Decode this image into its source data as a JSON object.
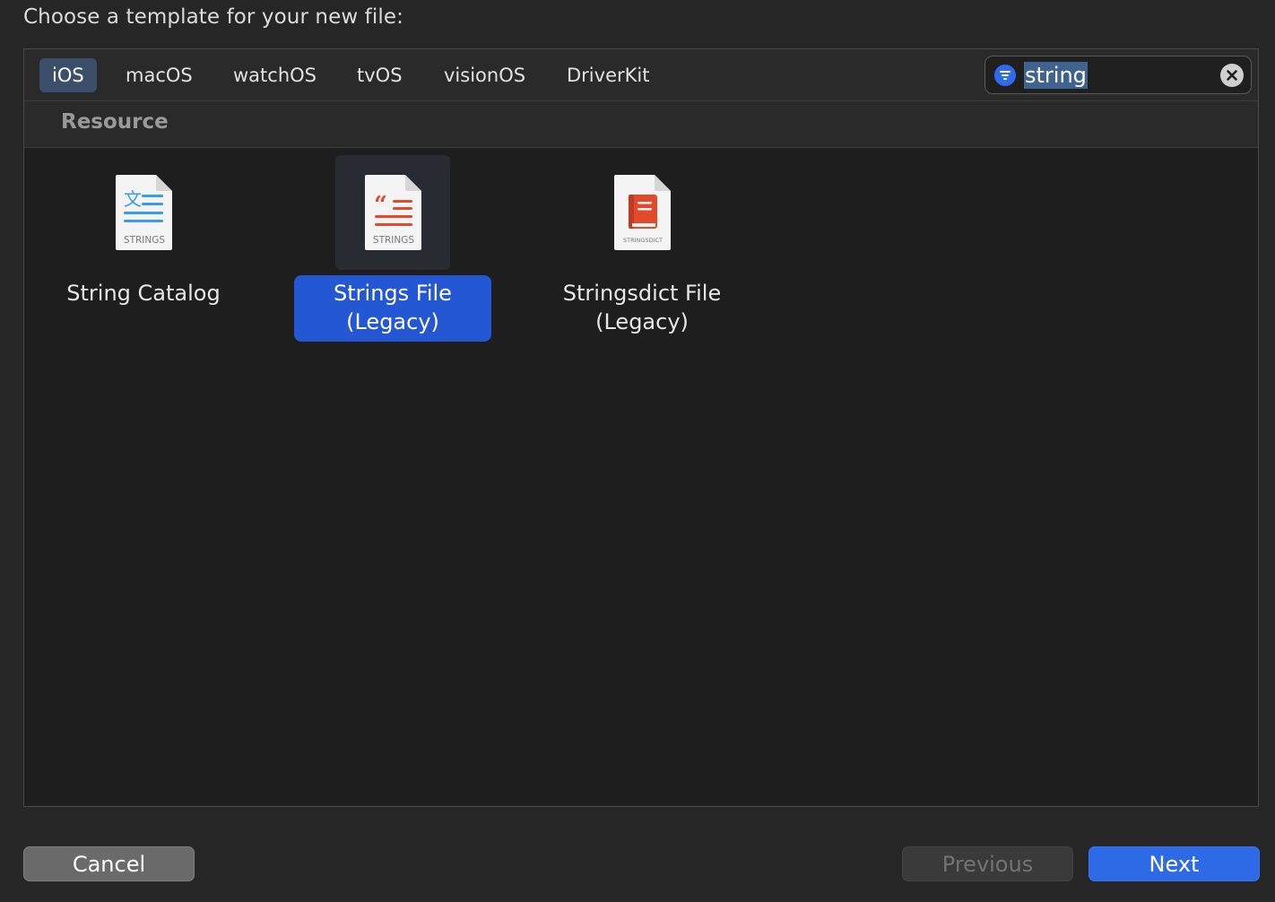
{
  "dialog": {
    "title": "Choose a template for your new file:"
  },
  "platform_tabs": [
    {
      "label": "iOS",
      "selected": true
    },
    {
      "label": "macOS",
      "selected": false
    },
    {
      "label": "watchOS",
      "selected": false
    },
    {
      "label": "tvOS",
      "selected": false
    },
    {
      "label": "visionOS",
      "selected": false
    },
    {
      "label": "DriverKit",
      "selected": false
    }
  ],
  "search": {
    "value": "string",
    "leading_icon": "filter-icon",
    "trailing_icon": "clear-icon"
  },
  "section": {
    "title": "Resource"
  },
  "templates": [
    {
      "label": "String Catalog",
      "icon": "string-catalog-icon",
      "badge": "STRINGS",
      "accent": "#3b9be8",
      "selected": false
    },
    {
      "label": "Strings File\n(Legacy)",
      "icon": "strings-file-icon",
      "badge": "STRINGS",
      "accent": "#e24a2c",
      "selected": true
    },
    {
      "label": "Stringsdict File\n(Legacy)",
      "icon": "stringsdict-file-icon",
      "badge": "STRINGSDICT",
      "accent": "#e24a2c",
      "selected": false
    }
  ],
  "buttons": {
    "cancel": "Cancel",
    "previous": "Previous",
    "next": "Next"
  },
  "colors": {
    "accent": "#2457d3",
    "primary_button": "#2f6ae6",
    "selected_tab": "#3b4f6b"
  }
}
